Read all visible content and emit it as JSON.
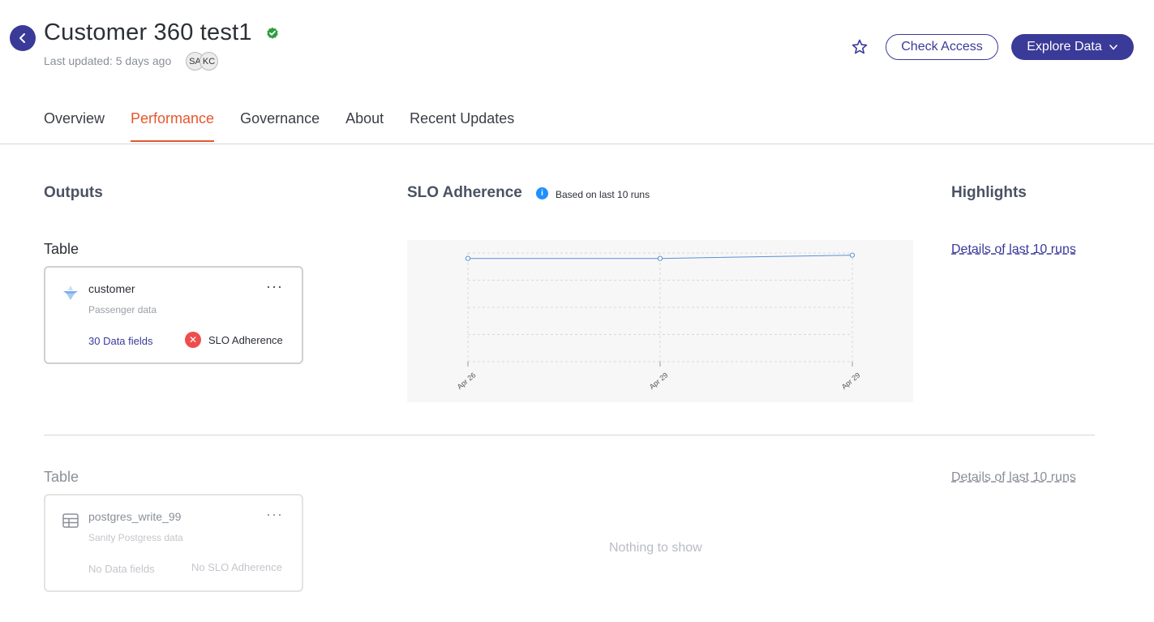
{
  "header": {
    "title": "Customer 360 test1",
    "last_updated": "Last updated: 5 days ago",
    "avatars": [
      "SA",
      "KC"
    ],
    "check_access_label": "Check Access",
    "explore_data_label": "Explore Data",
    "icons": {
      "back": "back-arrow-icon",
      "verified": "verified-check-icon",
      "favorite": "star-icon",
      "dropdown": "chevron-down-icon"
    }
  },
  "tabs": [
    {
      "label": "Overview",
      "active": false
    },
    {
      "label": "Performance",
      "active": true
    },
    {
      "label": "Governance",
      "active": false
    },
    {
      "label": "About",
      "active": false
    },
    {
      "label": "Recent Updates",
      "active": false
    }
  ],
  "sections": {
    "outputs": "Outputs",
    "slo": "SLO Adherence",
    "slo_note": "Based on last 10 runs",
    "highlights": "Highlights"
  },
  "outputs": [
    {
      "type_label": "Table",
      "name": "customer",
      "description": "Passenger data",
      "fields": "30 Data fields",
      "slo": "SLO Adherence",
      "icon": "iceberg-icon",
      "details_link": "Details of last 10 runs"
    },
    {
      "type_label": "Table",
      "name": "postgres_write_99",
      "description": "Sanity Postgress data",
      "fields": "No Data fields",
      "slo": "No SLO Adherence",
      "icon": "table-icon",
      "details_link": "Details of last 10 runs",
      "empty_message": "Nothing to show"
    }
  ],
  "chart_data": {
    "type": "line",
    "x": [
      "Apr 26",
      "Apr 29",
      "Apr 29"
    ],
    "series": [
      {
        "values": [
          0.95,
          0.95,
          0.98
        ]
      }
    ],
    "ylim": [
      0,
      1
    ],
    "grid": true,
    "line_color": "#5b8fd6"
  },
  "colors": {
    "brand": "#3a3a99",
    "active_tab": "#e4572e",
    "error": "#ef4d4d",
    "verified": "#2e9e3e",
    "info": "#1e90ff"
  }
}
